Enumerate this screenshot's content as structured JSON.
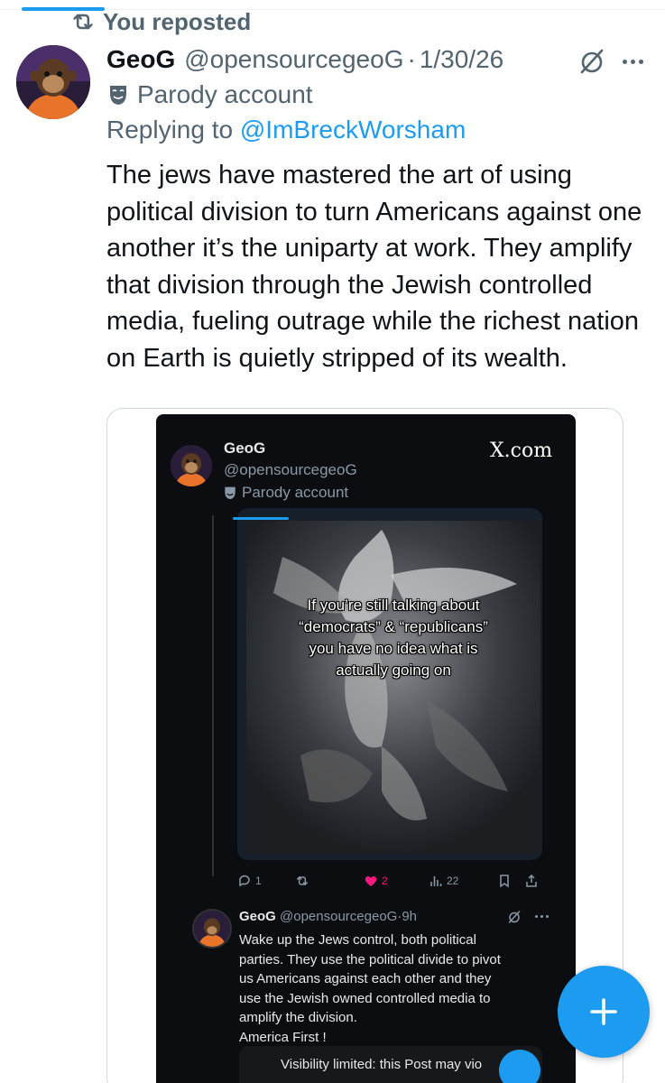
{
  "social_context": {
    "label": "You reposted"
  },
  "post": {
    "author_name": "GeoG",
    "author_handle": "@opensourcegeoG",
    "separator": "·",
    "date": "1/30/26",
    "badge": "Parody account",
    "replying_prefix": "Replying to ",
    "replying_to": "@ImBreckWorsham",
    "text": "The jews have mastered the art of using political division to turn Americans against one another it’s the uniparty at work. They amplify that division through the Jewish controlled media, fueling outrage while the richest nation on Earth is quietly stripped of its wealth."
  },
  "embedded_screenshot": {
    "author_name": "GeoG",
    "author_handle": "@opensourcegeoG",
    "badge": "Parody account",
    "watermark": "X.com",
    "meme_lines": [
      "If you’re still talking about",
      "“democrats” & “republicans”",
      "you have no idea what is",
      "actually going on"
    ],
    "actions": {
      "replies": "1",
      "likes": "2",
      "views": "22"
    },
    "reply": {
      "author_name": "GeoG",
      "author_handle": "@opensourcegeoG",
      "time": "9h",
      "lines": [
        "Wake up the Jews control, both political",
        "parties. They use the political divide to pivot",
        "us Americans against each other and they",
        "use the Jewish owned controlled media to",
        "amplify the division.",
        "America First !"
      ]
    },
    "visibility_notice": "Visibility limited: this Post may vio"
  },
  "icons": {
    "repost": "repost-icon",
    "grok": "grok-icon",
    "more": "more-icon",
    "parody": "parody-mask-icon",
    "compose": "compose-plus-icon"
  },
  "colors": {
    "accent": "#1d9bf0",
    "text": "#0f1419",
    "secondary": "#536471",
    "like": "#f91880"
  }
}
